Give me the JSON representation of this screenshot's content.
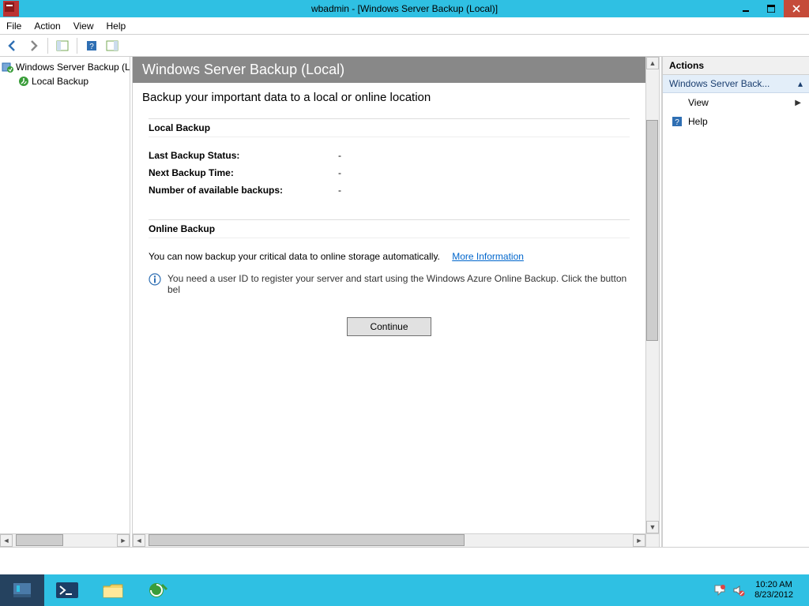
{
  "window": {
    "title": "wbadmin - [Windows Server Backup (Local)]"
  },
  "menubar": {
    "items": [
      "File",
      "Action",
      "View",
      "Help"
    ]
  },
  "tree": {
    "root": "Windows Server Backup (L",
    "child": "Local Backup"
  },
  "center": {
    "header": "Windows Server Backup (Local)",
    "subtitle": "Backup your important data to a local or online location",
    "local_section_title": "Local Backup",
    "rows": {
      "last_status_label": "Last Backup Status:",
      "last_status_value": "-",
      "next_time_label": "Next Backup Time:",
      "next_time_value": "-",
      "count_label": "Number of available backups:",
      "count_value": "-"
    },
    "online_section_title": "Online Backup",
    "online_text": "You can now backup your critical data to online storage automatically.",
    "online_more": "More Information",
    "info_text": "You need a user ID to register your server and start using the Windows Azure Online Backup. Click the button bel",
    "continue_label": "Continue"
  },
  "actions": {
    "header": "Actions",
    "group_title": "Windows Server Back...",
    "items": {
      "view": "View",
      "help": "Help"
    }
  },
  "taskbar": {
    "time": "10:20 AM",
    "date": "8/23/2012"
  }
}
